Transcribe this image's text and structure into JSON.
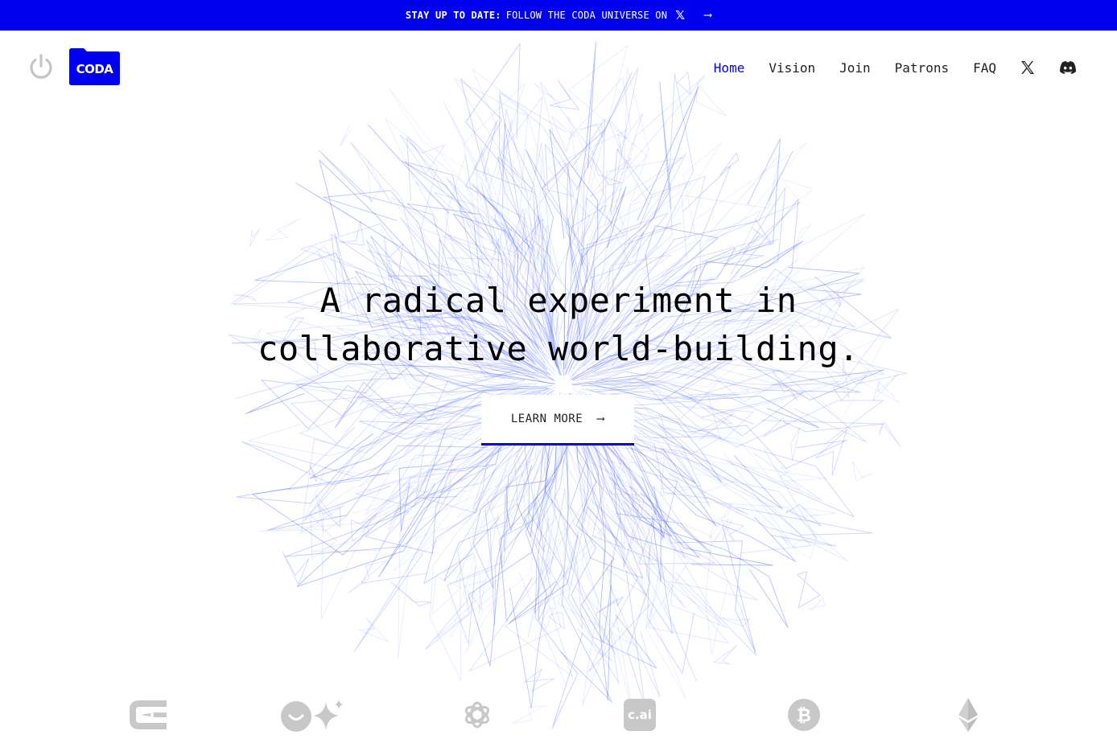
{
  "announcement": {
    "lead": "STAY UP TO DATE:",
    "text": "FOLLOW THE CODA UNIVERSE ON",
    "x_glyph": "𝕏",
    "arrow": "⟶"
  },
  "brand": {
    "logo_text": "CODA",
    "accent": "#0000ee",
    "power_icon": "power-icon"
  },
  "nav": {
    "items": [
      {
        "label": "Home",
        "active": true
      },
      {
        "label": "Vision"
      },
      {
        "label": "Join"
      },
      {
        "label": "Patrons"
      },
      {
        "label": "FAQ"
      }
    ],
    "x_icon": "x-icon",
    "discord_icon": "discord-icon"
  },
  "hero": {
    "line1": "A radical experiment in",
    "line2": "collaborative world-building.",
    "cta_label": "LEARN MORE",
    "cta_arrow": "⟶",
    "background": "blue wireframe burst"
  },
  "partners": [
    "stack-logo-icon",
    "smile-sparkle-icon",
    "openai-icon",
    "character-ai-icon",
    "bitcoin-icon",
    "ethereum-icon"
  ],
  "partner_texts": {
    "cai": "c.ai",
    "btc": "₿"
  }
}
